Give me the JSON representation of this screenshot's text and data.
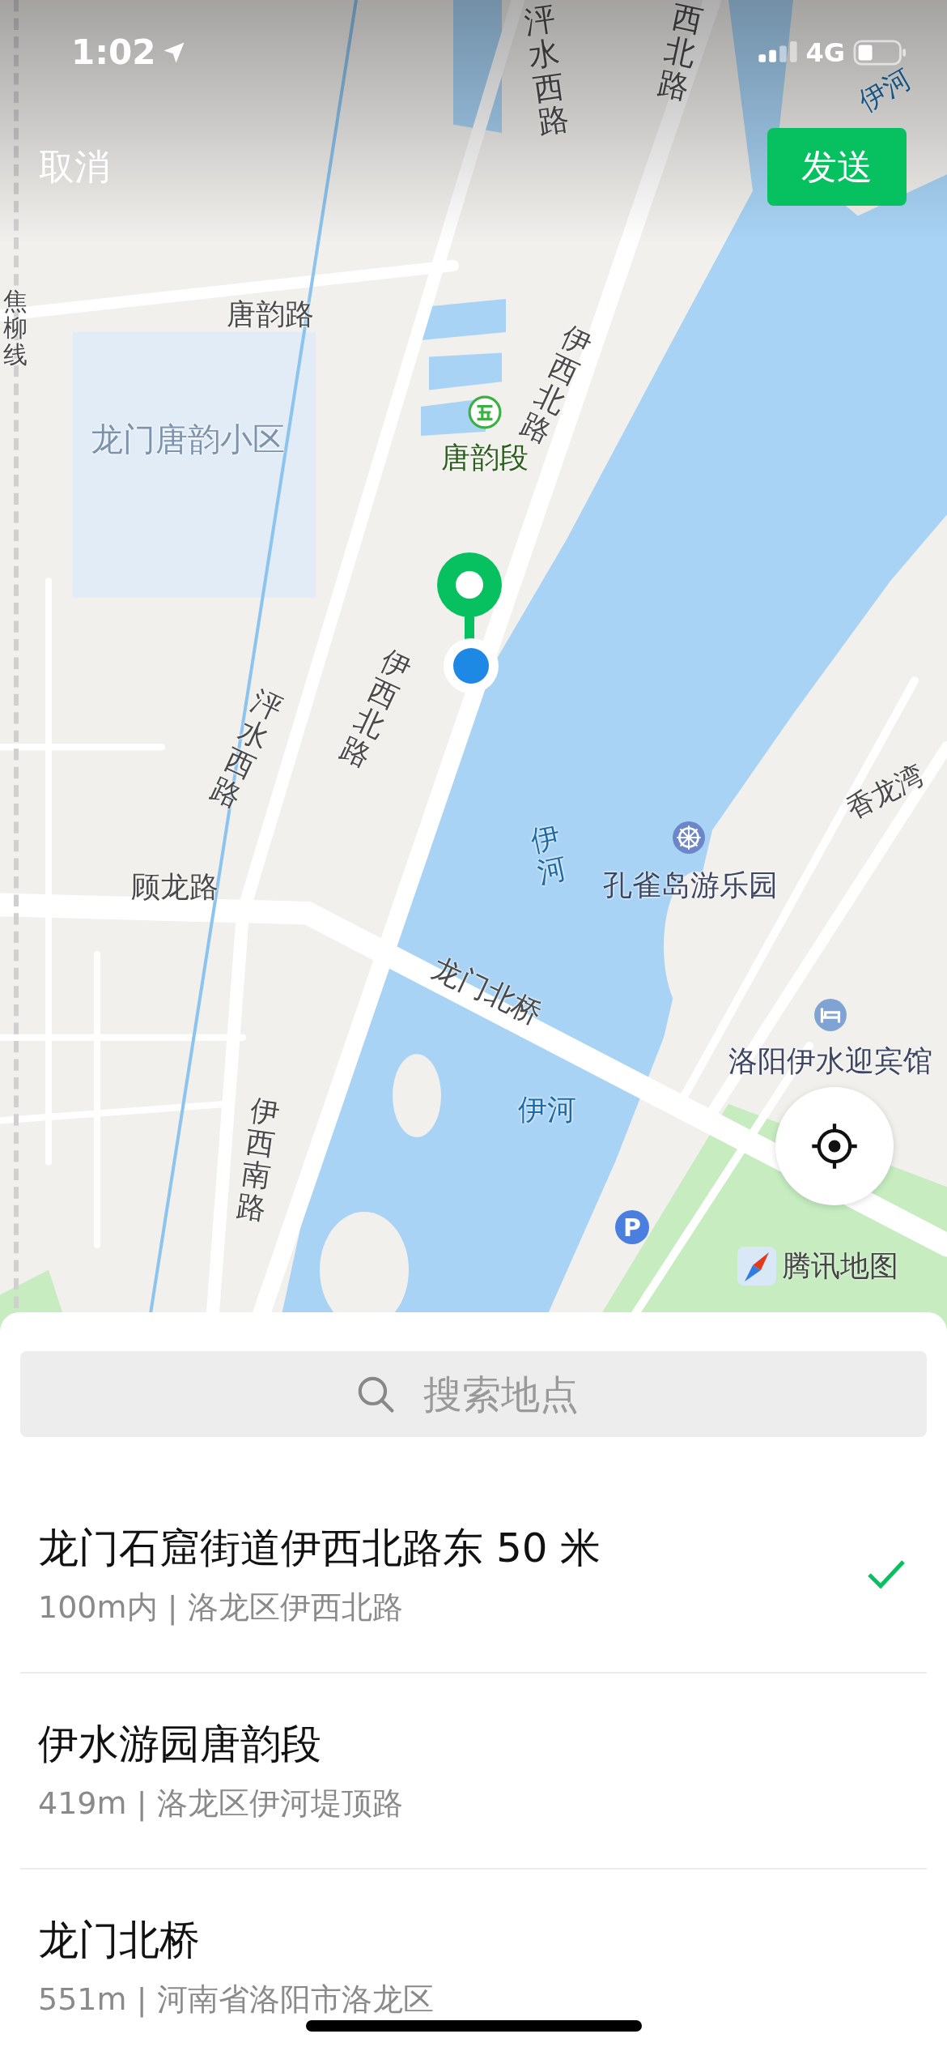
{
  "status_bar": {
    "time": "1:02",
    "network": "4G"
  },
  "nav": {
    "cancel": "取消",
    "send": "发送"
  },
  "map": {
    "labels": [
      {
        "text": "泙水西路",
        "kind": "road"
      },
      {
        "text": "西北路",
        "kind": "road"
      },
      {
        "text": "伊河",
        "kind": "water"
      },
      {
        "text": "唐韵路",
        "kind": "road"
      },
      {
        "text": "焦柳线",
        "kind": "road"
      },
      {
        "text": "龙门唐韵小区",
        "kind": "area"
      },
      {
        "text": "伊西北路",
        "kind": "road"
      },
      {
        "text": "唐韵段",
        "kind": "park"
      },
      {
        "text": "伊西北路",
        "kind": "road"
      },
      {
        "text": "泙水西路",
        "kind": "road"
      },
      {
        "text": "伊河",
        "kind": "water"
      },
      {
        "text": "孔雀岛游乐园",
        "kind": "poi"
      },
      {
        "text": "香龙湾",
        "kind": "road"
      },
      {
        "text": "顾龙路",
        "kind": "road"
      },
      {
        "text": "龙门北桥",
        "kind": "road"
      },
      {
        "text": "洛阳伊水迎宾馆",
        "kind": "poi"
      },
      {
        "text": "伊河",
        "kind": "water"
      },
      {
        "text": "伊西南路",
        "kind": "road"
      }
    ],
    "parking_sign": "P",
    "attribution": "腾讯地图"
  },
  "search": {
    "placeholder": "搜索地点"
  },
  "places": [
    {
      "name": "龙门石窟街道伊西北路东 50 米",
      "detail": "100m内 | 洛龙区伊西北路",
      "selected": true
    },
    {
      "name": "伊水游园唐韵段",
      "detail": "419m | 洛龙区伊河堤顶路",
      "selected": false
    },
    {
      "name": "龙门北桥",
      "detail": "551m | 河南省洛阳市洛龙区",
      "selected": false
    }
  ]
}
